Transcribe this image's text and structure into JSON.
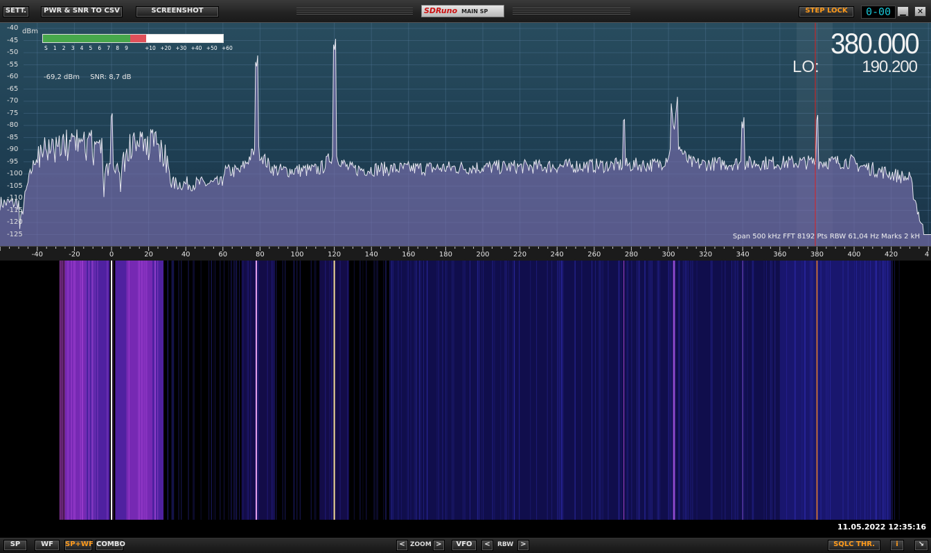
{
  "toolbar": {
    "settings_label": "SETT.",
    "pwr_snr_label": "PWR & SNR TO CSV",
    "screenshot_label": "SCREENSHOT",
    "brand": "SDRuno",
    "panel_name": "MAIN SP",
    "step_lock_label": "STEP LOCK",
    "clock_display": "0-00",
    "minimize_glyph": "▁",
    "close_glyph": "✕"
  },
  "spectrum": {
    "y_unit": "dBm",
    "y_ticks": [
      "-40",
      "-45",
      "-50",
      "-55",
      "-60",
      "-65",
      "-70",
      "-75",
      "-80",
      "-85",
      "-90",
      "-95",
      "-100",
      "-105",
      "-110",
      "-115",
      "-120",
      "-125"
    ],
    "frequency": "380.000",
    "lo_label": "LO:",
    "lo_value": "190.200",
    "power_readout": "-69,2 dBm",
    "snr_readout": "SNR: 8,7 dB",
    "info": "Span 500 kHz   FFT 8192 Pts   RBW 61,04 Hz   Marks 2 kH",
    "smeter_level_fraction": 0.485,
    "smeter_peak_fraction": 0.575,
    "smeter_ticks": [
      "S",
      "1",
      "2",
      "3",
      "4",
      "5",
      "6",
      "7",
      "8",
      "9",
      "+10",
      "+20",
      "+30",
      "+40",
      "+50",
      "+60"
    ],
    "x_ticks": [
      "-40",
      "-20",
      "0",
      "20",
      "40",
      "60",
      "80",
      "100",
      "120",
      "140",
      "160",
      "180",
      "200",
      "220",
      "240",
      "260",
      "280",
      "300",
      "320",
      "340",
      "360",
      "380",
      "400",
      "420",
      "4"
    ],
    "colors": {
      "background_top": "#284c5e",
      "fill": "#7a6fae",
      "trace": "#e8e8f0",
      "grid": "#5a7ea0",
      "vfo_line": "#e02020"
    }
  },
  "waterfall": {
    "datetime": "11.05.2022 12:35:16"
  },
  "bottombar": {
    "sp_label": "SP",
    "wf_label": "WF",
    "spwf_label": "SP+WF",
    "combo_label": "COMBO",
    "zoom_left": "<",
    "zoom_label": "ZOOM",
    "zoom_right": ">",
    "vfo_label": "VFO",
    "rbw_left": "<",
    "rbw_label": "RBW",
    "rbw_right": ">",
    "sqlc_label": "SQLC THR.",
    "info_label": "i",
    "resize_glyph": "↘"
  }
}
